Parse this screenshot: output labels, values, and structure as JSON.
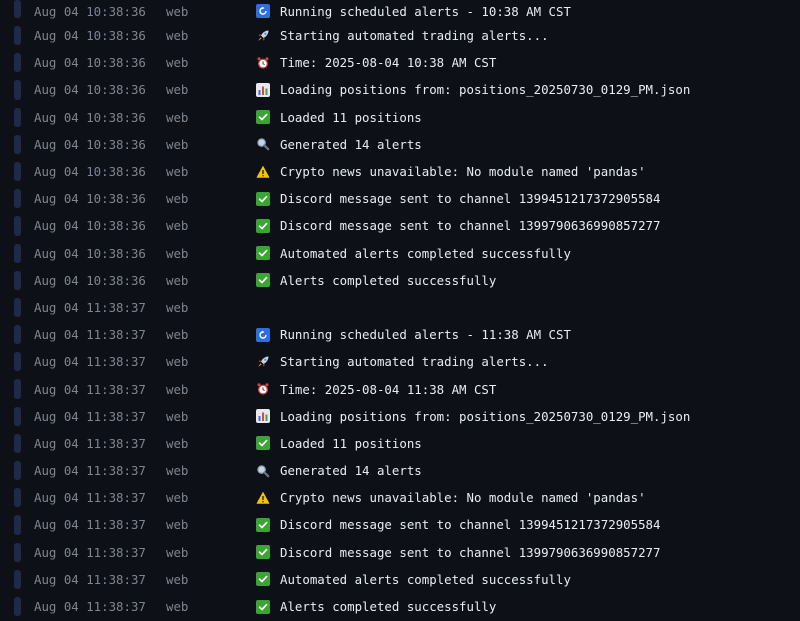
{
  "colors": {
    "background": "#0d1117",
    "marker": "#1f2a4b",
    "muted_text": "#7d8590",
    "message_text": "#e6edf3",
    "success_icon": "#3ba534",
    "refresh_icon": "#2f6fdc",
    "warning_icon": "#f2c500"
  },
  "logs": [
    {
      "timestamp": "Aug 04 10:38:36",
      "source": "web",
      "icon": "refresh-icon",
      "message": "Running scheduled alerts - 10:38 AM CST"
    },
    {
      "timestamp": "Aug 04 10:38:36",
      "source": "web",
      "icon": "rocket-icon",
      "message": "Starting automated trading alerts..."
    },
    {
      "timestamp": "Aug 04 10:38:36",
      "source": "web",
      "icon": "alarm-clock-icon",
      "message": "Time: 2025-08-04 10:38 AM CST"
    },
    {
      "timestamp": "Aug 04 10:38:36",
      "source": "web",
      "icon": "bar-chart-icon",
      "message": "Loading positions from: positions_20250730_0129_PM.json"
    },
    {
      "timestamp": "Aug 04 10:38:36",
      "source": "web",
      "icon": "check-icon",
      "message": "Loaded 11 positions"
    },
    {
      "timestamp": "Aug 04 10:38:36",
      "source": "web",
      "icon": "magnifier-icon",
      "message": "Generated 14 alerts"
    },
    {
      "timestamp": "Aug 04 10:38:36",
      "source": "web",
      "icon": "warning-icon",
      "message": "Crypto news unavailable: No module named 'pandas'"
    },
    {
      "timestamp": "Aug 04 10:38:36",
      "source": "web",
      "icon": "check-icon",
      "message": "Discord message sent to channel 1399451217372905584"
    },
    {
      "timestamp": "Aug 04 10:38:36",
      "source": "web",
      "icon": "check-icon",
      "message": "Discord message sent to channel 1399790636990857277"
    },
    {
      "timestamp": "Aug 04 10:38:36",
      "source": "web",
      "icon": "check-icon",
      "message": "Automated alerts completed successfully"
    },
    {
      "timestamp": "Aug 04 10:38:36",
      "source": "web",
      "icon": "check-icon",
      "message": "Alerts completed successfully"
    },
    {
      "timestamp": "Aug 04 11:38:37",
      "source": "web",
      "icon": "",
      "message": ""
    },
    {
      "timestamp": "Aug 04 11:38:37",
      "source": "web",
      "icon": "refresh-icon",
      "message": "Running scheduled alerts - 11:38 AM CST"
    },
    {
      "timestamp": "Aug 04 11:38:37",
      "source": "web",
      "icon": "rocket-icon",
      "message": "Starting automated trading alerts..."
    },
    {
      "timestamp": "Aug 04 11:38:37",
      "source": "web",
      "icon": "alarm-clock-icon",
      "message": "Time: 2025-08-04 11:38 AM CST"
    },
    {
      "timestamp": "Aug 04 11:38:37",
      "source": "web",
      "icon": "bar-chart-icon",
      "message": "Loading positions from: positions_20250730_0129_PM.json"
    },
    {
      "timestamp": "Aug 04 11:38:37",
      "source": "web",
      "icon": "check-icon",
      "message": "Loaded 11 positions"
    },
    {
      "timestamp": "Aug 04 11:38:37",
      "source": "web",
      "icon": "magnifier-icon",
      "message": "Generated 14 alerts"
    },
    {
      "timestamp": "Aug 04 11:38:37",
      "source": "web",
      "icon": "warning-icon",
      "message": "Crypto news unavailable: No module named 'pandas'"
    },
    {
      "timestamp": "Aug 04 11:38:37",
      "source": "web",
      "icon": "check-icon",
      "message": "Discord message sent to channel 1399451217372905584"
    },
    {
      "timestamp": "Aug 04 11:38:37",
      "source": "web",
      "icon": "check-icon",
      "message": "Discord message sent to channel 1399790636990857277"
    },
    {
      "timestamp": "Aug 04 11:38:37",
      "source": "web",
      "icon": "check-icon",
      "message": "Automated alerts completed successfully"
    },
    {
      "timestamp": "Aug 04 11:38:37",
      "source": "web",
      "icon": "check-icon",
      "message": "Alerts completed successfully"
    }
  ]
}
